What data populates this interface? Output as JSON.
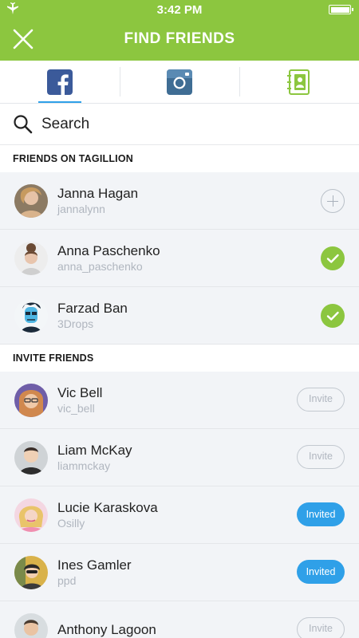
{
  "status_bar": {
    "time": "3:42 PM"
  },
  "header": {
    "title": "FIND FRIENDS"
  },
  "tabs": [
    {
      "name": "facebook",
      "icon": "facebook-icon",
      "active": true
    },
    {
      "name": "instagram",
      "icon": "instagram-icon",
      "active": false
    },
    {
      "name": "contacts",
      "icon": "contacts-book-icon",
      "active": false
    }
  ],
  "search": {
    "placeholder": "Search"
  },
  "friends_section": {
    "title": "FRIENDS ON TAGILLION",
    "items": [
      {
        "name": "Janna Hagan",
        "handle": "jannalynn",
        "status": "add"
      },
      {
        "name": "Anna Paschenko",
        "handle": "anna_paschenko",
        "status": "added"
      },
      {
        "name": "Farzad Ban",
        "handle": "3Drops",
        "status": "added"
      }
    ]
  },
  "invite_section": {
    "title": "INVITE FRIENDS",
    "items": [
      {
        "name": "Vic Bell",
        "handle": "vic_bell",
        "button": "Invite",
        "invited": false
      },
      {
        "name": "Liam McKay",
        "handle": "liammckay",
        "button": "Invite",
        "invited": false
      },
      {
        "name": "Lucie Karaskova",
        "handle": "Osilly",
        "button": "Invited",
        "invited": true
      },
      {
        "name": "Ines Gamler",
        "handle": "ppd",
        "button": "Invited",
        "invited": true
      },
      {
        "name": "Anthony Lagoon",
        "handle": "",
        "button": "Invite",
        "invited": false
      }
    ]
  },
  "colors": {
    "brand_green": "#8cc63f",
    "accent_blue": "#2fa0e8"
  }
}
